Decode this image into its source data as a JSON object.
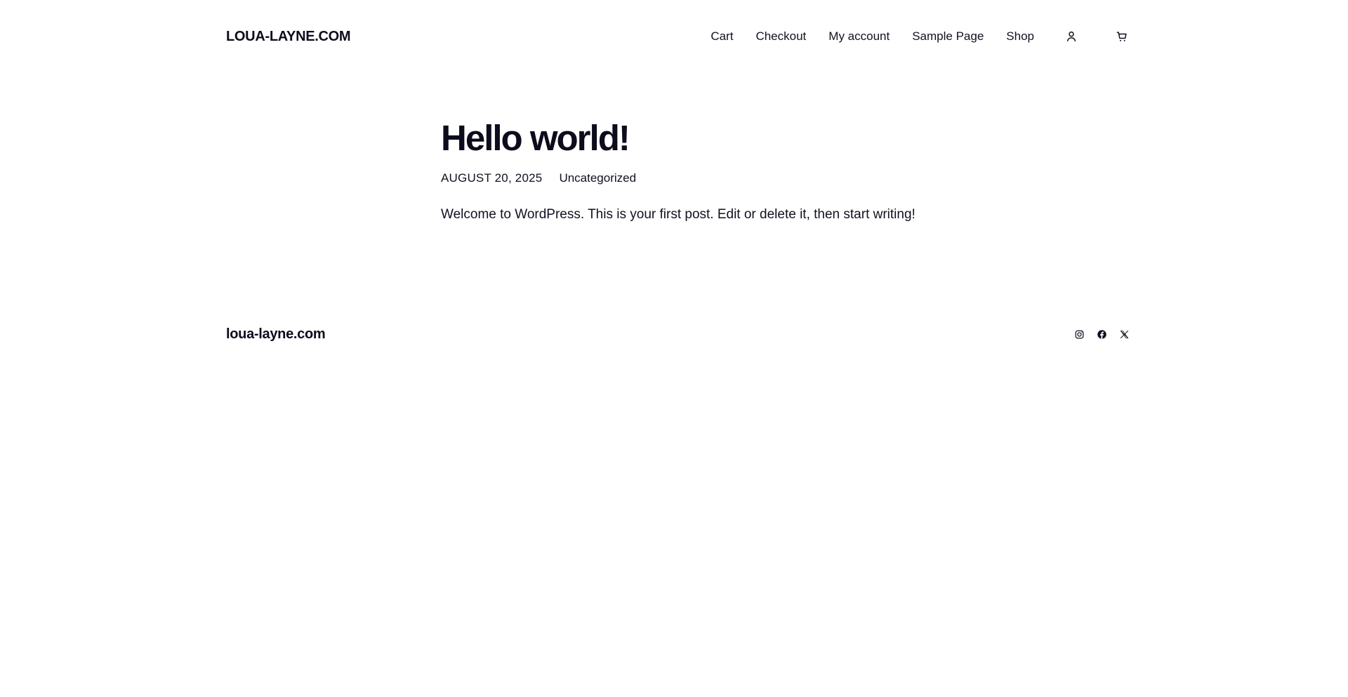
{
  "header": {
    "site_title": "LOUA-LAYNE.COM",
    "nav": [
      {
        "label": "Cart"
      },
      {
        "label": "Checkout"
      },
      {
        "label": "My account"
      },
      {
        "label": "Sample Page"
      },
      {
        "label": "Shop"
      }
    ],
    "icons": {
      "account": "user-icon",
      "cart": "cart-icon"
    }
  },
  "post": {
    "title": "Hello world!",
    "date": "AUGUST 20, 2025",
    "category": "Uncategorized",
    "body": "Welcome to WordPress. This is your first post. Edit or delete it, then start writing!"
  },
  "footer": {
    "site_title": "loua-layne.com",
    "social": [
      "instagram-icon",
      "facebook-icon",
      "x-icon"
    ]
  },
  "colors": {
    "text": "#0c0c1c",
    "background": "#ffffff"
  }
}
